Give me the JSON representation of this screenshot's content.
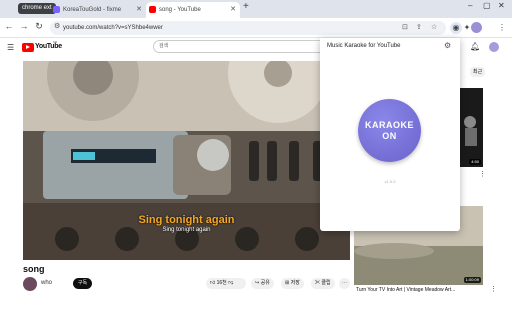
{
  "browser": {
    "profile_chip": "chrome ext",
    "tabs": [
      {
        "title": "KoreaTouGold - fixme"
      },
      {
        "title": "song - YouTube"
      }
    ],
    "new_tab": "+",
    "url": "youtube.com/watch?v=sYShbe4wwer"
  },
  "youtube": {
    "logo_text": "YouTube",
    "logo_country": "KR",
    "search_placeholder": "검색",
    "video": {
      "title": "song",
      "caption_main": "Sing tonight again",
      "caption_sub": "Sing tonight again"
    },
    "channel": {
      "name": "who",
      "subscribe_label": "구독"
    },
    "actions": {
      "like": "16천",
      "share": "공유",
      "save": "저장",
      "clip": "클립"
    },
    "chips": [
      "최근"
    ],
    "thumbnails": [
      {
        "duration": "4:50"
      },
      {
        "duration": "1:00:09",
        "title": "Turn Your TV Into Art | Vintage Meadow Art..."
      }
    ]
  },
  "extension_popup": {
    "title": "Music Karaoke for YouTube",
    "button_line1": "KARAOKE",
    "button_line2": "ON",
    "version": "v1.0.0"
  },
  "colors": {
    "accent": "#6a63cc",
    "caption": "#f5a623",
    "youtube_red": "#ff0000"
  }
}
